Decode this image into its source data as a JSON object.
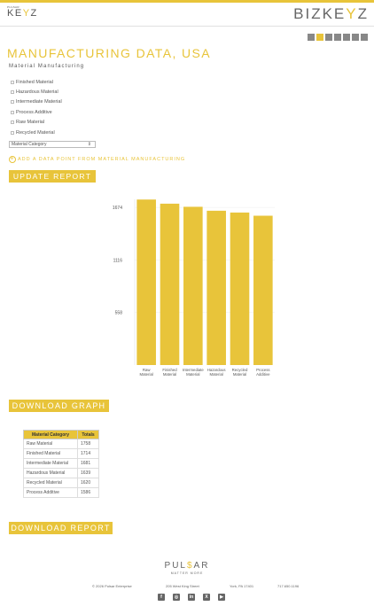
{
  "header": {
    "left_logo_small": "PULSAR",
    "left_logo_main_1": "KE",
    "left_logo_main_hl": "Y",
    "left_logo_main_2": "Z",
    "right_logo_1": "BIZKE",
    "right_logo_hl": "Y",
    "right_logo_2": "Z"
  },
  "toolbar": {
    "icons": [
      "list-icon",
      "bar-chart-icon",
      "pie-chart-icon",
      "line-chart-icon",
      "table-icon",
      "settings-icon",
      "close-icon"
    ],
    "accent": "#e8c43a"
  },
  "page": {
    "title": "MANUFACTURING DATA, USA",
    "section_label": "Material Manufacturing"
  },
  "filters": [
    "Finished Material",
    "Hazardous Material",
    "Intermediate Material",
    "Process Additive",
    "Raw Material",
    "Recycled Material"
  ],
  "select": {
    "value": "Material Category",
    "arrow": "⇕"
  },
  "actions": {
    "add_data_point": "ADD A DATA POINT FROM MATERIAL MANUFACTURING",
    "update_report": "UPDATE REPORT",
    "download_graph": "DOWNLOAD GRAPH",
    "download_report": "DOWNLOAD REPORT"
  },
  "chart_data": {
    "type": "bar",
    "categories": [
      "Raw Material",
      "Finished Material",
      "Intermediate Material",
      "Hazardous Material",
      "Recycled Material",
      "Process Additive"
    ],
    "values": [
      1758,
      1714,
      1681,
      1639,
      1620,
      1586
    ],
    "yticks": [
      558,
      1116,
      1674
    ],
    "ylim": [
      0,
      1760
    ],
    "color": "#e8c43a"
  },
  "table": {
    "headers": [
      "Material Category",
      "Totals"
    ],
    "rows": [
      [
        "Raw Material",
        "1758"
      ],
      [
        "Finished Material",
        "1714"
      ],
      [
        "Intermediate Material",
        "1681"
      ],
      [
        "Hazardous Material",
        "1639"
      ],
      [
        "Recycled Material",
        "1620"
      ],
      [
        "Process Additive",
        "1586"
      ]
    ]
  },
  "footer": {
    "logo_1": "PUL",
    "logo_hl": "$",
    "logo_2": "AR",
    "tagline": "MATTER MORE",
    "copyright": "© 2026 Pulsar Enterprise",
    "address": "205 West King Street",
    "city": "York, PA 17401",
    "phone": "717.650.1196",
    "social": [
      "facebook-icon",
      "instagram-icon",
      "linkedin-icon",
      "x-icon",
      "youtube-icon"
    ]
  }
}
